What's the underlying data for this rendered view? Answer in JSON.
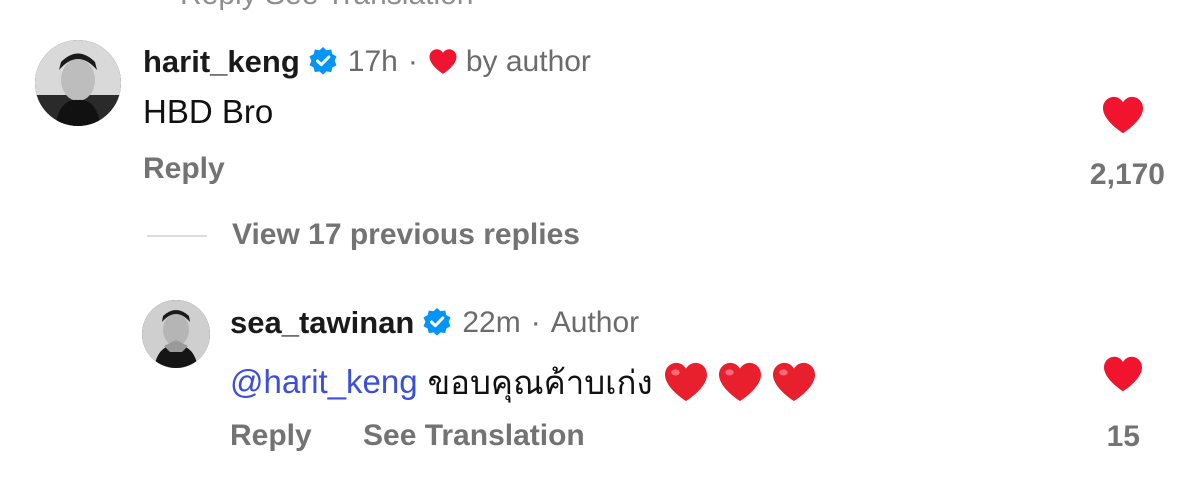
{
  "top_partial": {
    "text": "Reply   See Translation"
  },
  "comment": {
    "username": "harit_keng",
    "time": "17h",
    "separator": "·",
    "liked_by": "by author",
    "text": "HBD Bro",
    "reply_label": "Reply",
    "like_count": "2,170"
  },
  "view_replies": {
    "label": "View 17 previous replies"
  },
  "reply": {
    "username": "sea_tawinan",
    "time": "22m",
    "separator": "·",
    "author_label": "Author",
    "mention": "@harit_keng",
    "text": "ขอบคุณค้าบเก่ง",
    "emoji_count": 3,
    "reply_label": "Reply",
    "translate_label": "See Translation",
    "like_count": "15"
  },
  "colors": {
    "heart_red": "#f0142f",
    "verified_blue": "#0095f6",
    "mention_blue": "#3b4fd8",
    "muted_gray": "#737373"
  },
  "icons": {
    "verified": "verified-badge-icon",
    "author_like": "heart-icon",
    "like": "heart-icon",
    "emoji": "red-heart-emoji"
  }
}
